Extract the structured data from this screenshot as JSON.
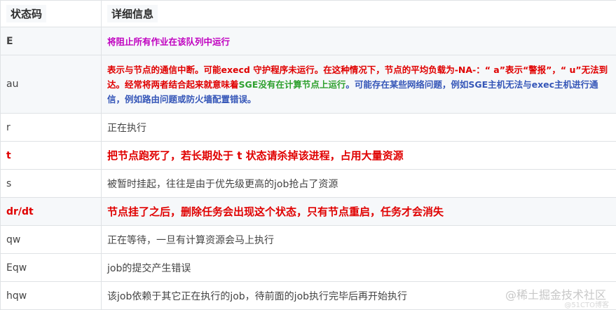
{
  "table": {
    "headers": [
      "状态码",
      "详细信息"
    ],
    "rows": [
      {
        "code": "E",
        "detail": "将阻止所有作业在该队列中运行"
      },
      {
        "code": "au",
        "detail_segments": [
          "表示与节点的通信中断。可能execd 守护程序未运行。在这种情况下，节点的平均负载为-NA-：“ a”表示“警报”，“ u”无法到达。经常将两者结合起来就意味着",
          "SGE没有在计算节点上运行",
          "。可能存在某些网络问题，例如SGE主机无法与exec主机进行通信，例如路由问题或防火墙配置错误。"
        ]
      },
      {
        "code": "r",
        "detail": "正在执行"
      },
      {
        "code": "t",
        "detail": "把节点跑死了，若长期处于 t 状态请杀掉该进程，占用大量资源"
      },
      {
        "code": "s",
        "detail": "被暂时挂起，往往是由于优先级更高的job抢占了资源"
      },
      {
        "code": "dr/dt",
        "detail": "节点挂了之后，删除任务会出现这个状态，只有节点重启，任务才会消失"
      },
      {
        "code": "qw",
        "detail": "正在等待，一旦有计算资源会马上执行"
      },
      {
        "code": "Eqw",
        "detail": "job的提交产生错误"
      },
      {
        "code": "hqw",
        "detail": "该job依赖于其它正在执行的job，待前面的job执行完毕后再开始执行"
      }
    ]
  },
  "watermark": {
    "text": "@稀土掘金技术社区",
    "sub": "@51CTO博客"
  },
  "colors": {
    "red": "#e00000",
    "purple": "#c000c0",
    "green": "#2ea02e",
    "blue": "#3556b8",
    "stripe": "#f6f8fa"
  }
}
